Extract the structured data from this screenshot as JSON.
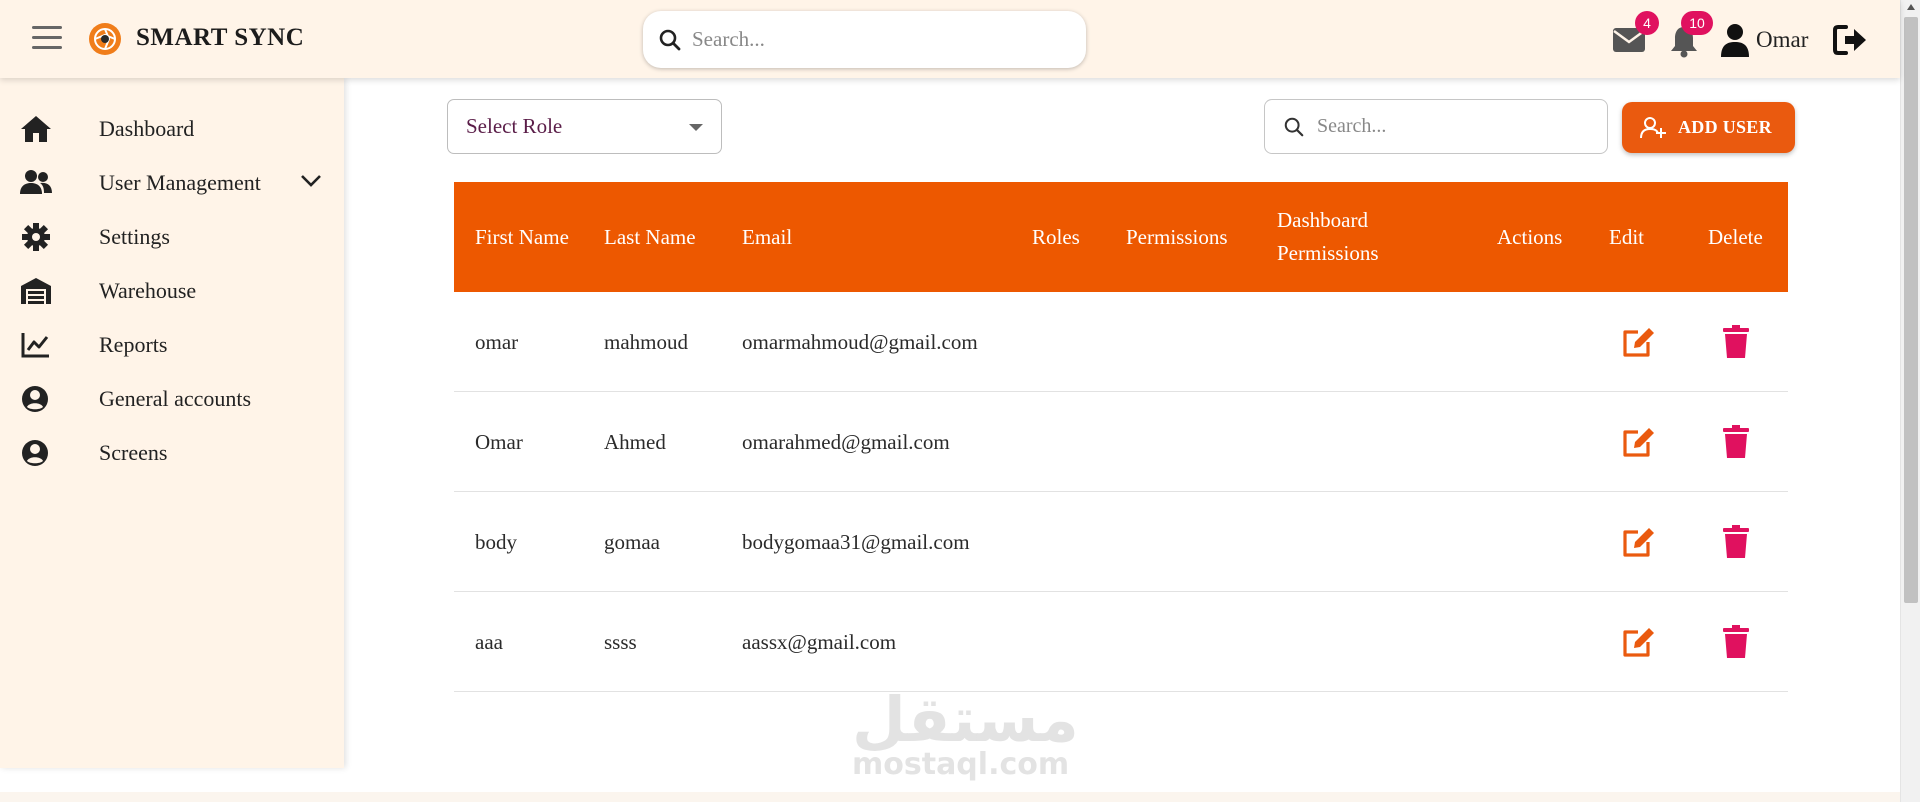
{
  "header": {
    "brand": "SMART SYNC",
    "search_placeholder": "Search...",
    "mail_count": "4",
    "notification_count": "10",
    "user_name": "Omar"
  },
  "sidebar": {
    "items": [
      {
        "label": "Dashboard",
        "icon": "home-icon"
      },
      {
        "label": "User Management",
        "icon": "users-icon",
        "expandable": true
      },
      {
        "label": "Settings",
        "icon": "gear-icon"
      },
      {
        "label": "Warehouse",
        "icon": "warehouse-icon"
      },
      {
        "label": "Reports",
        "icon": "chart-line-icon"
      },
      {
        "label": "General accounts",
        "icon": "user-circle-icon"
      },
      {
        "label": "Screens",
        "icon": "user-circle-icon"
      }
    ]
  },
  "controls": {
    "role_select_value": "Select Role",
    "search_placeholder": "Search...",
    "add_user_label": "ADD USER"
  },
  "table": {
    "headers": [
      "First Name",
      "Last Name",
      "Email",
      "Roles",
      "Permissions",
      "Dashboard Permissions",
      "Actions",
      "Edit",
      "Delete"
    ],
    "rows": [
      {
        "first": "omar",
        "last": "mahmoud",
        "email": "omarmahmoud@gmail.com",
        "roles": "",
        "permissions": "",
        "dashboard_permissions": "",
        "actions": ""
      },
      {
        "first": "Omar",
        "last": "Ahmed",
        "email": "omarahmed@gmail.com",
        "roles": "",
        "permissions": "",
        "dashboard_permissions": "",
        "actions": ""
      },
      {
        "first": "body",
        "last": "gomaa",
        "email": "bodygomaa31@gmail.com",
        "roles": "",
        "permissions": "",
        "dashboard_permissions": "",
        "actions": ""
      },
      {
        "first": "aaa",
        "last": "ssss",
        "email": "aassx@gmail.com",
        "roles": "",
        "permissions": "",
        "dashboard_permissions": "",
        "actions": ""
      }
    ]
  },
  "watermark": {
    "arabic": "مستقل",
    "latin": "mostaql.com"
  },
  "colors": {
    "accent": "#ed5800",
    "header_bg": "#fff4e8",
    "delete": "#e0115f",
    "badge": "#e0115f"
  }
}
